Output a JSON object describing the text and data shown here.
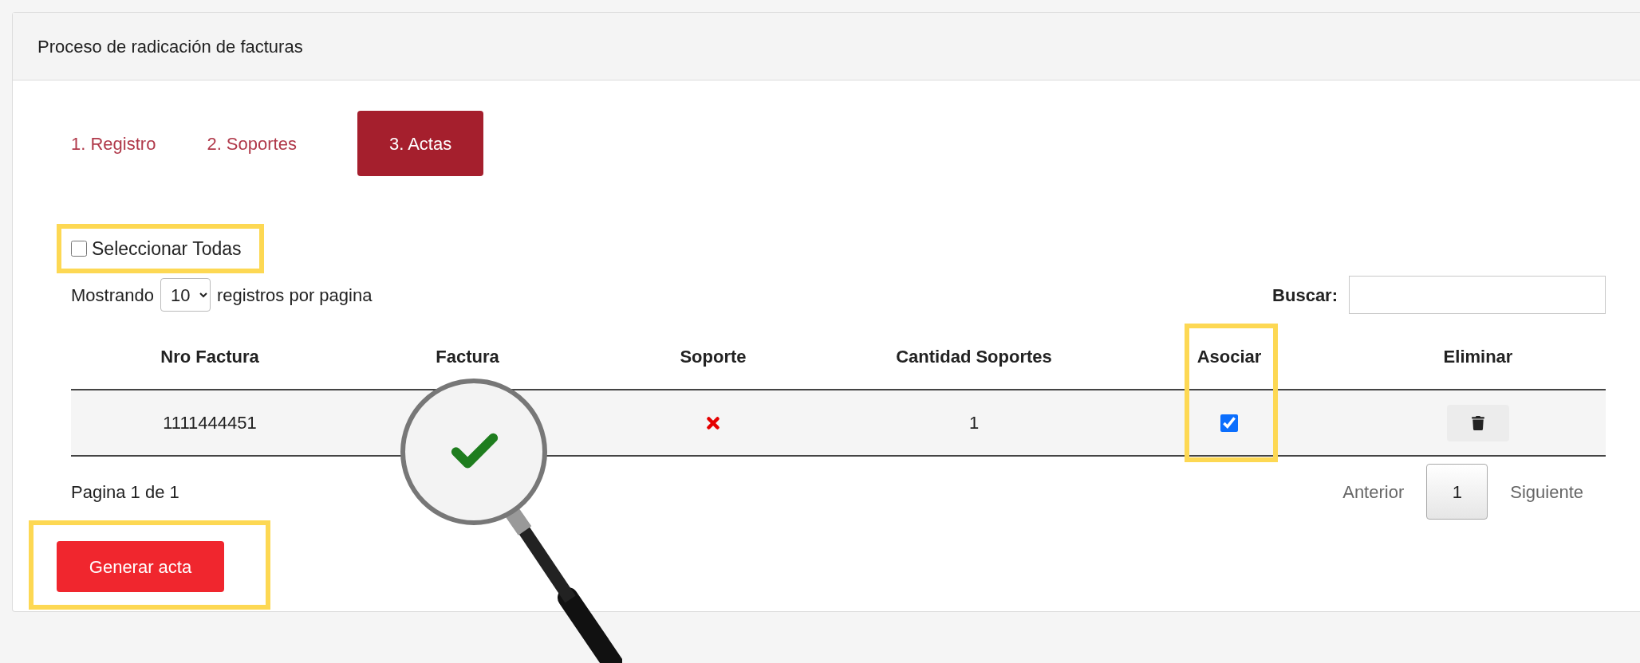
{
  "panel": {
    "title": "Proceso de radicación de facturas"
  },
  "tabs": [
    {
      "label": "1. Registro",
      "selected": false
    },
    {
      "label": "2. Soportes",
      "selected": false
    },
    {
      "label": "3. Actas",
      "selected": true
    }
  ],
  "select_all": {
    "label": "Seleccionar Todas",
    "checked": false,
    "highlighted": true
  },
  "page_size": {
    "prefix": "Mostrando",
    "value": "10",
    "suffix": "registros por pagina"
  },
  "search": {
    "label": "Buscar:"
  },
  "table": {
    "columns": [
      {
        "label": "Nro Factura",
        "highlighted": false
      },
      {
        "label": "Factura",
        "highlighted": false
      },
      {
        "label": "Soporte",
        "highlighted": false
      },
      {
        "label": "Cantidad Soportes",
        "highlighted": false
      },
      {
        "label": "Asociar",
        "highlighted": true
      },
      {
        "label": "Eliminar",
        "highlighted": false
      }
    ],
    "rows": [
      {
        "nro_factura": "1111444451",
        "factura_attached": true,
        "soporte_attached": false,
        "cantidad_soportes": "1",
        "asociar": true
      }
    ]
  },
  "pagination": {
    "info": "Pagina 1 de 1",
    "previous": "Anterior",
    "current": "1",
    "next": "Siguiente"
  },
  "generate_button": {
    "label": "Generar acta",
    "highlighted": true
  }
}
